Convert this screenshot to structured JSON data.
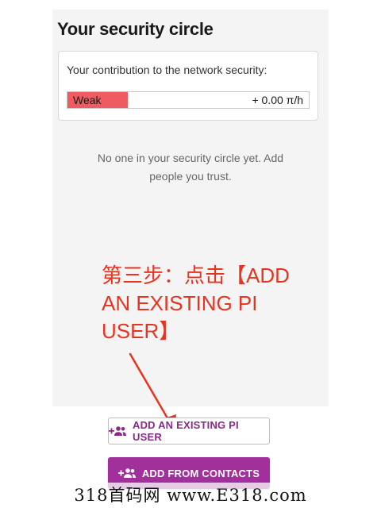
{
  "security_circle": {
    "title": "Your security circle",
    "contribution_label": "Your contribution to the network security:",
    "strength_label": "Weak",
    "strength_fraction": 0.25,
    "rate": "+ 0.00 π/h",
    "empty_message": "No one in your security circle yet. Add people you trust."
  },
  "annotation": {
    "text": "第三步：点击【ADD AN EXISTING PI USER】"
  },
  "buttons": {
    "add_existing": "ADD AN EXISTING PI USER",
    "add_contacts": "ADD FROM CONTACTS"
  },
  "watermark": {
    "text": "318首码网 www.E318.com"
  },
  "icons": {
    "add_user": "group-add-icon",
    "arrow": "arrow-annotation-icon"
  },
  "colors": {
    "accent": "#a1309d",
    "weak": "#ef5b60",
    "annotation": "#e8331f"
  }
}
